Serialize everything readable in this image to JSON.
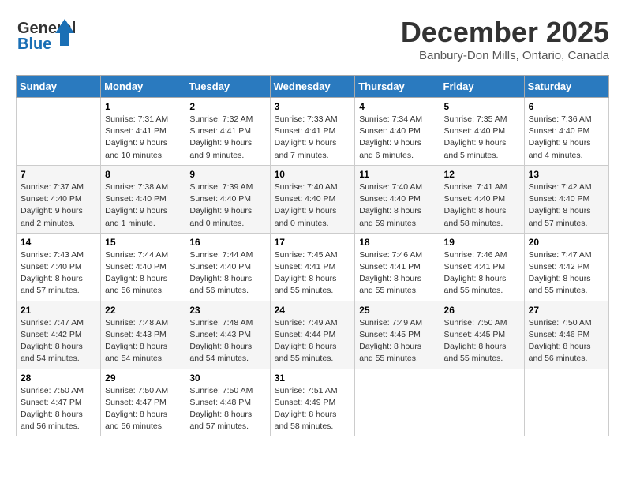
{
  "logo": {
    "line1": "General",
    "line2": "Blue"
  },
  "title": "December 2025",
  "location": "Banbury-Don Mills, Ontario, Canada",
  "days_of_week": [
    "Sunday",
    "Monday",
    "Tuesday",
    "Wednesday",
    "Thursday",
    "Friday",
    "Saturday"
  ],
  "weeks": [
    [
      {
        "day": "",
        "info": ""
      },
      {
        "day": "1",
        "info": "Sunrise: 7:31 AM\nSunset: 4:41 PM\nDaylight: 9 hours\nand 10 minutes."
      },
      {
        "day": "2",
        "info": "Sunrise: 7:32 AM\nSunset: 4:41 PM\nDaylight: 9 hours\nand 9 minutes."
      },
      {
        "day": "3",
        "info": "Sunrise: 7:33 AM\nSunset: 4:41 PM\nDaylight: 9 hours\nand 7 minutes."
      },
      {
        "day": "4",
        "info": "Sunrise: 7:34 AM\nSunset: 4:40 PM\nDaylight: 9 hours\nand 6 minutes."
      },
      {
        "day": "5",
        "info": "Sunrise: 7:35 AM\nSunset: 4:40 PM\nDaylight: 9 hours\nand 5 minutes."
      },
      {
        "day": "6",
        "info": "Sunrise: 7:36 AM\nSunset: 4:40 PM\nDaylight: 9 hours\nand 4 minutes."
      }
    ],
    [
      {
        "day": "7",
        "info": "Sunrise: 7:37 AM\nSunset: 4:40 PM\nDaylight: 9 hours\nand 2 minutes."
      },
      {
        "day": "8",
        "info": "Sunrise: 7:38 AM\nSunset: 4:40 PM\nDaylight: 9 hours\nand 1 minute."
      },
      {
        "day": "9",
        "info": "Sunrise: 7:39 AM\nSunset: 4:40 PM\nDaylight: 9 hours\nand 0 minutes."
      },
      {
        "day": "10",
        "info": "Sunrise: 7:40 AM\nSunset: 4:40 PM\nDaylight: 9 hours\nand 0 minutes."
      },
      {
        "day": "11",
        "info": "Sunrise: 7:40 AM\nSunset: 4:40 PM\nDaylight: 8 hours\nand 59 minutes."
      },
      {
        "day": "12",
        "info": "Sunrise: 7:41 AM\nSunset: 4:40 PM\nDaylight: 8 hours\nand 58 minutes."
      },
      {
        "day": "13",
        "info": "Sunrise: 7:42 AM\nSunset: 4:40 PM\nDaylight: 8 hours\nand 57 minutes."
      }
    ],
    [
      {
        "day": "14",
        "info": "Sunrise: 7:43 AM\nSunset: 4:40 PM\nDaylight: 8 hours\nand 57 minutes."
      },
      {
        "day": "15",
        "info": "Sunrise: 7:44 AM\nSunset: 4:40 PM\nDaylight: 8 hours\nand 56 minutes."
      },
      {
        "day": "16",
        "info": "Sunrise: 7:44 AM\nSunset: 4:40 PM\nDaylight: 8 hours\nand 56 minutes."
      },
      {
        "day": "17",
        "info": "Sunrise: 7:45 AM\nSunset: 4:41 PM\nDaylight: 8 hours\nand 55 minutes."
      },
      {
        "day": "18",
        "info": "Sunrise: 7:46 AM\nSunset: 4:41 PM\nDaylight: 8 hours\nand 55 minutes."
      },
      {
        "day": "19",
        "info": "Sunrise: 7:46 AM\nSunset: 4:41 PM\nDaylight: 8 hours\nand 55 minutes."
      },
      {
        "day": "20",
        "info": "Sunrise: 7:47 AM\nSunset: 4:42 PM\nDaylight: 8 hours\nand 55 minutes."
      }
    ],
    [
      {
        "day": "21",
        "info": "Sunrise: 7:47 AM\nSunset: 4:42 PM\nDaylight: 8 hours\nand 54 minutes."
      },
      {
        "day": "22",
        "info": "Sunrise: 7:48 AM\nSunset: 4:43 PM\nDaylight: 8 hours\nand 54 minutes."
      },
      {
        "day": "23",
        "info": "Sunrise: 7:48 AM\nSunset: 4:43 PM\nDaylight: 8 hours\nand 54 minutes."
      },
      {
        "day": "24",
        "info": "Sunrise: 7:49 AM\nSunset: 4:44 PM\nDaylight: 8 hours\nand 55 minutes."
      },
      {
        "day": "25",
        "info": "Sunrise: 7:49 AM\nSunset: 4:45 PM\nDaylight: 8 hours\nand 55 minutes."
      },
      {
        "day": "26",
        "info": "Sunrise: 7:50 AM\nSunset: 4:45 PM\nDaylight: 8 hours\nand 55 minutes."
      },
      {
        "day": "27",
        "info": "Sunrise: 7:50 AM\nSunset: 4:46 PM\nDaylight: 8 hours\nand 56 minutes."
      }
    ],
    [
      {
        "day": "28",
        "info": "Sunrise: 7:50 AM\nSunset: 4:47 PM\nDaylight: 8 hours\nand 56 minutes."
      },
      {
        "day": "29",
        "info": "Sunrise: 7:50 AM\nSunset: 4:47 PM\nDaylight: 8 hours\nand 56 minutes."
      },
      {
        "day": "30",
        "info": "Sunrise: 7:50 AM\nSunset: 4:48 PM\nDaylight: 8 hours\nand 57 minutes."
      },
      {
        "day": "31",
        "info": "Sunrise: 7:51 AM\nSunset: 4:49 PM\nDaylight: 8 hours\nand 58 minutes."
      },
      {
        "day": "",
        "info": ""
      },
      {
        "day": "",
        "info": ""
      },
      {
        "day": "",
        "info": ""
      }
    ]
  ]
}
